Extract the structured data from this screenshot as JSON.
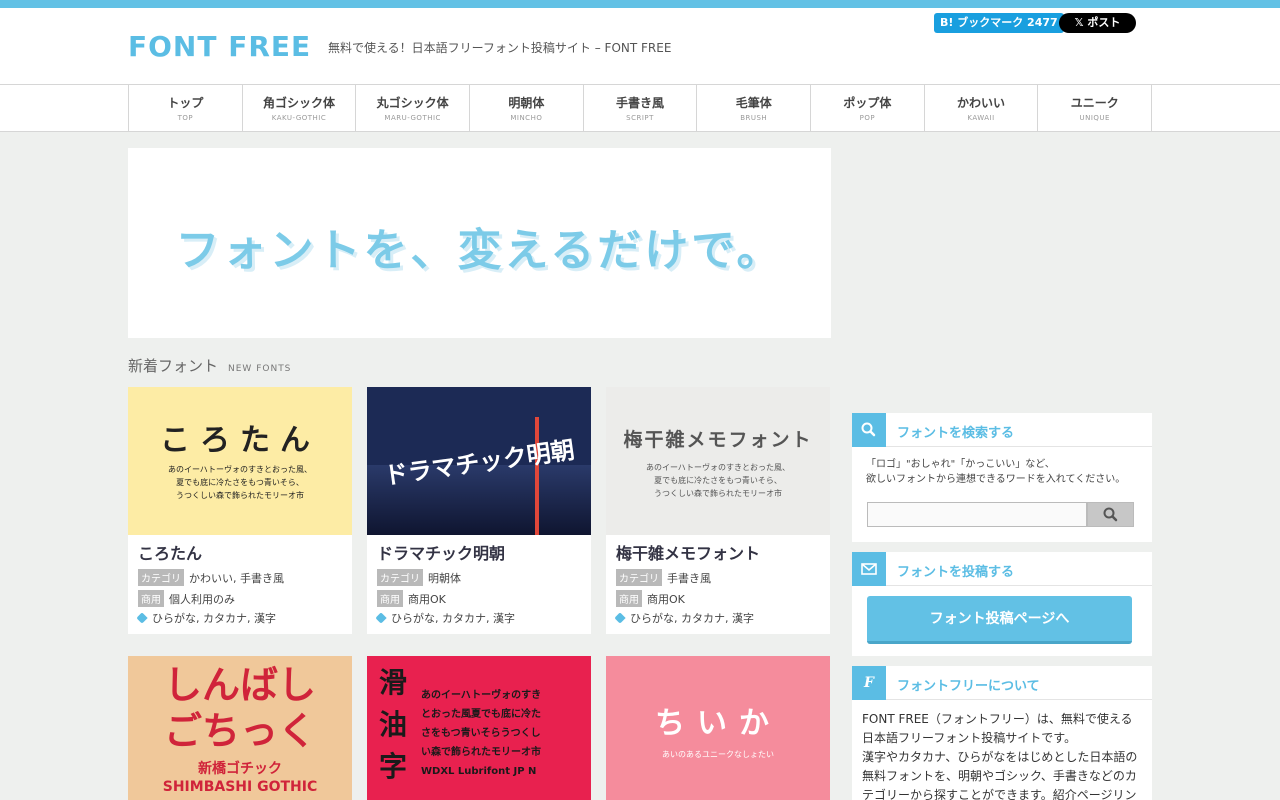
{
  "header": {
    "logo": "FONT FREE",
    "tagline": "無料で使える！日本語フリーフォント投稿サイト – FONT FREE",
    "hatena_label": "B! ブックマーク 2477",
    "x_post_label": "𝕏 ポスト"
  },
  "nav": [
    {
      "label": "トップ",
      "sub": "TOP"
    },
    {
      "label": "角ゴシック体",
      "sub": "KAKU-GOTHIC"
    },
    {
      "label": "丸ゴシック体",
      "sub": "MARU-GOTHIC"
    },
    {
      "label": "明朝体",
      "sub": "MINCHO"
    },
    {
      "label": "手書き風",
      "sub": "SCRIPT"
    },
    {
      "label": "毛筆体",
      "sub": "BRUSH"
    },
    {
      "label": "ポップ体",
      "sub": "POP"
    },
    {
      "label": "かわいい",
      "sub": "KAWAII"
    },
    {
      "label": "ユニーク",
      "sub": "UNIQUE"
    }
  ],
  "hero": {
    "text": "フォントを、変えるだけで。"
  },
  "section": {
    "title": "新着フォント",
    "sub": "NEW FONTS"
  },
  "labels": {
    "category": "カテゴリ",
    "commercial": "商用"
  },
  "cards": [
    {
      "thumb_title": "ころたん",
      "thumb_sample": "あのイーハトーヴォのすきとおった風、\n夏でも底に冷たさをもつ青いそら、\nうつくしい森で飾られたモリーオ市",
      "title": "ころたん",
      "category": "かわいい, 手書き風",
      "commercial": "個人利用のみ",
      "tags": "ひらがな, カタカナ, 漢字",
      "bg": "#fdeca5",
      "fg": "#222222"
    },
    {
      "thumb_title": "ドラマチック明朝",
      "thumb_sample": "",
      "title": "ドラマチック明朝",
      "category": "明朝体",
      "commercial": "商用OK",
      "tags": "ひらがな, カタカナ, 漢字",
      "bg": "#1c2a55",
      "fg": "#ffffff"
    },
    {
      "thumb_title": "梅干雑メモフォント",
      "thumb_sample": "あのイーハトーヴォのすきとおった風、\n夏でも底に冷たさをもつ青いそら、\nうつくしい森で飾られたモリーオ市",
      "title": "梅干雑メモフォント",
      "category": "手書き風",
      "commercial": "商用OK",
      "tags": "ひらがな, カタカナ, 漢字",
      "bg": "#ececea",
      "fg": "#555555"
    },
    {
      "thumb_title": "しんばし\nごちっく",
      "thumb_sample": "新橋ゴチック\nSHIMBASHI GOTHIC",
      "bg": "#f0c89a",
      "fg": "#d0243a"
    },
    {
      "thumb_title": "滑\n油\n字",
      "thumb_sample": "あのイーハトーヴォのすき\nとおった風夏でも底に冷た\nさをもつ青いそらうつくし\nい森で飾られたモリーオ市\nWDXL Lubrifont JP N",
      "bg": "#e8214f",
      "fg": "#1a1a1a"
    },
    {
      "thumb_title": "ちいか",
      "thumb_sample": "あいのあるユニークなしょたい",
      "bg": "#f58c9c",
      "fg": "#ffffff"
    }
  ],
  "sidebar": {
    "search": {
      "title": "フォントを検索する",
      "desc": "「ロゴ」\"おしゃれ\"「かっこいい」など、\n欲しいフォントから連想できるワードを入れてください。",
      "icon": "search-icon"
    },
    "post": {
      "title": "フォントを投稿する",
      "button": "フォント投稿ページへ",
      "icon": "mail-icon"
    },
    "about": {
      "title": "フォントフリーについて",
      "icon_glyph": "F",
      "text": "FONT FREE（フォントフリー）は、無料で使える日本語フリーフォント投稿サイトです。\n漢字やカタカナ、ひらがなをはじめとした日本語の無料フォントを、明朝やゴシック、手書きなどのカテゴリーから探すことができます。紹介ページリン"
    }
  },
  "colors": {
    "accent": "#5bbde4",
    "topbar": "#62c1e5",
    "background": "#eef0ee"
  }
}
